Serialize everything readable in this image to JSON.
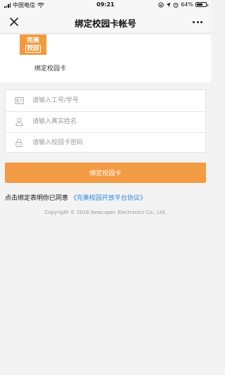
{
  "status_bar": {
    "carrier": "中国电信",
    "time": "09:21",
    "battery": "64%",
    "battery_level": 0.64
  },
  "nav": {
    "title": "绑定校园卡帐号"
  },
  "header": {
    "logo_line1": "完美",
    "logo_line2": "校园",
    "card_label": "绑定校园卡"
  },
  "form": {
    "id_placeholder": "请输入工号/学号",
    "name_placeholder": "请输入真实姓名",
    "password_placeholder": "请输入校园卡密码"
  },
  "bind_button_label": "绑定校园卡",
  "agreement": {
    "prefix": "点击绑定表明你已同意",
    "link": "《完美校园开放平台协议》"
  },
  "copyright": "Copyright © 2016 Newcapec Electronics Co., Ltd.",
  "colors": {
    "accent": "#f49b45",
    "link": "#2b86e0"
  }
}
